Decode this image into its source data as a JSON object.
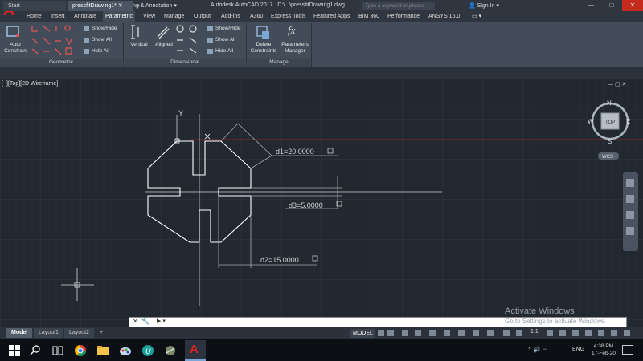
{
  "app": {
    "title": "Autodesk AutoCAD 2017",
    "file_path": "D:\\...\\pressfitDrawing1.dwg",
    "logo_letter": "A",
    "workspace": "Drafting & Annotation",
    "search_placeholder": "Type a keyword or phrase",
    "signin": "Sign In"
  },
  "menu_tabs": [
    "Home",
    "Insert",
    "Annotate",
    "Parametric",
    "View",
    "Manage",
    "Output",
    "Add-ins",
    "A360",
    "Express Tools",
    "Featured Apps",
    "BIM 360",
    "Performance",
    "ANSYS 16.0"
  ],
  "active_tab": "Parametric",
  "ribbon": {
    "geometric": {
      "title": "Geometric",
      "auto_constrain": [
        "Auto",
        "Constrain"
      ],
      "show_hide": "Show/Hide",
      "show_all": "Show All",
      "hide_all": "Hide All"
    },
    "dimensional": {
      "title": "Dimensional",
      "vertical": "Vertical",
      "aligned": "Aligned",
      "show_hide": "Show/Hide",
      "show_all": "Show All",
      "hide_all": "Hide All"
    },
    "manage": {
      "title": "Manage",
      "delete_constraints": [
        "Delete",
        "Constraints"
      ],
      "parameters_manager": [
        "Parameters",
        "Manager"
      ]
    }
  },
  "file_tabs": {
    "start": "Start",
    "drawing": "pressfitDrawing1*"
  },
  "viewport": {
    "label": "[−][Top][2D Wireframe]",
    "y_axis": "Y",
    "viewcube": {
      "north": "N",
      "south": "S",
      "east": "E",
      "west": "W",
      "face": "TOP",
      "wcs": "WCS"
    },
    "dims": {
      "d1": "d1=20.0000",
      "d2": "d2=15.0000",
      "d3": "d3=5.0000"
    },
    "accent_line_color": "#8a2a30",
    "geometry_color": "#ffffff"
  },
  "command_line": {
    "prompt": "Type a command"
  },
  "layout_tabs": [
    "Model",
    "Layout1",
    "Layout2"
  ],
  "status": {
    "model": "MODEL",
    "scale": "1:1"
  },
  "watermark": {
    "title": "Activate Windows",
    "subtitle": "Go to Settings to activate Windows."
  },
  "taskbar": {
    "lang": "ENG",
    "time": "4:38 PM",
    "date": "17-Feb-20"
  }
}
